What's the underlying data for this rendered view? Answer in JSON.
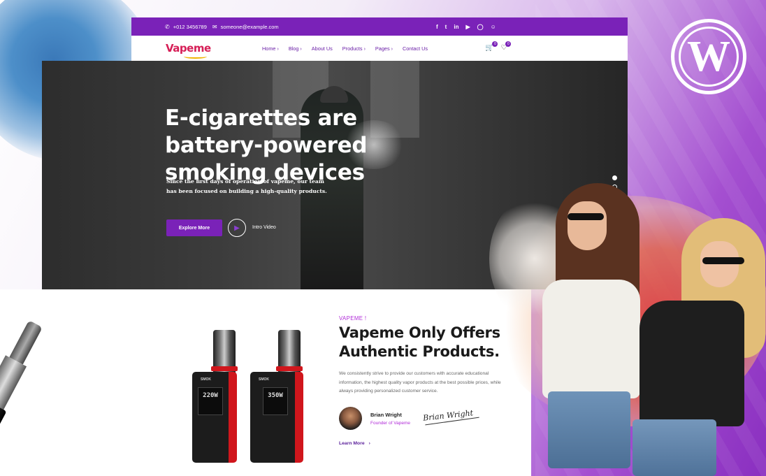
{
  "topbar": {
    "phone": "+012 3456789",
    "email": "someone@example.com",
    "socials": [
      "facebook-icon",
      "twitter-icon",
      "linkedin-icon",
      "youtube-icon",
      "instagram-icon",
      "user-icon"
    ]
  },
  "nav": {
    "logo": "Vapeme",
    "items": [
      {
        "label": "Home",
        "has_dropdown": true
      },
      {
        "label": "Blog",
        "has_dropdown": true
      },
      {
        "label": "About Us",
        "has_dropdown": false
      },
      {
        "label": "Products",
        "has_dropdown": true
      },
      {
        "label": "Pages",
        "has_dropdown": true
      },
      {
        "label": "Contact Us",
        "has_dropdown": false
      }
    ],
    "cart_count": "0",
    "wishlist_count": "0"
  },
  "hero": {
    "title": "E-cigarettes are battery-powered smoking devices",
    "subtitle": "Since the first days of operation of vapeme, our team has been focused on building a high-quality products.",
    "cta_label": "Explore More",
    "video_label": "Intro Video",
    "slides": 2,
    "active_slide": 1
  },
  "about": {
    "kicker": "VAPEME !",
    "title": "Vapeme Only Offers Authentic Products.",
    "body": "We consistently strive to provide our customers with accurate educational information, the highest quality vapor products at the best possible prices, while always providing personalized customer service.",
    "author_name": "Brian Wright",
    "author_role": "Founder of Vapeme",
    "signature": "Brian Wright",
    "link_label": "Learn More"
  },
  "products": {
    "mod_brand": "SMOK",
    "mod1_screen": "220W",
    "mod2_screen": "350W"
  },
  "colors": {
    "brand_purple": "#7a22b8",
    "logo_red": "#d61f57",
    "accent_magenta": "#b02ad8"
  }
}
